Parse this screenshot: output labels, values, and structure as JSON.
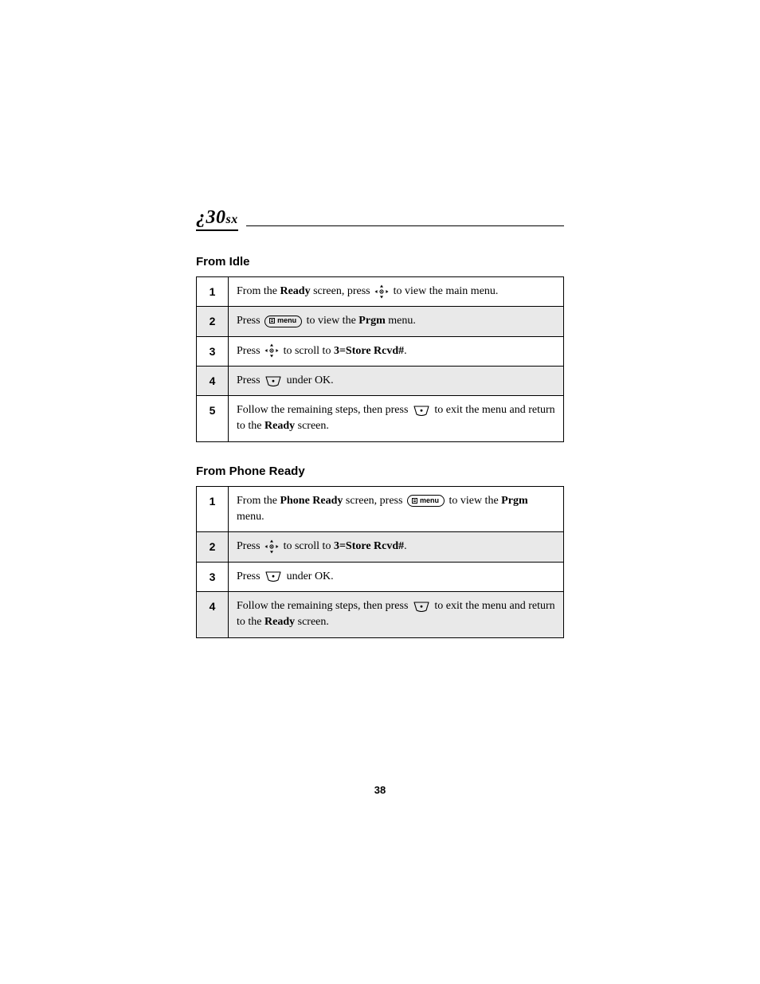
{
  "model_html": "<span>¿30</span><span class=\"sx\">sx</span>",
  "page_number": "38",
  "sectionA": {
    "title": "From Idle",
    "rows": [
      {
        "num": "1",
        "html": "From the <span class=\"bold-inline\">Ready</span> screen, press {{scroll}} to view the main menu."
      },
      {
        "num": "2",
        "html": "Press {{menu}} to view the <span class=\"bold-inline\">Prgm</span> menu."
      },
      {
        "num": "3",
        "html": "Press {{scroll}} to scroll to <span class=\"bold-inline\">3=Store Rcvd#</span>."
      },
      {
        "num": "4",
        "html": "Press {{ok}} under OK."
      },
      {
        "num": "5",
        "html": "Follow the remaining steps, then press {{ok}} to exit the menu and return to the <span class=\"bold-inline\">Ready</span> screen."
      }
    ]
  },
  "sectionB": {
    "title": "From Phone Ready",
    "rows": [
      {
        "num": "1",
        "html": "From the <span class=\"bold-inline\">Phone Ready</span> screen, press {{menu}} to view the <span class=\"bold-inline\">Prgm</span> menu."
      },
      {
        "num": "2",
        "html": "Press {{scroll}} to scroll to <span class=\"bold-inline\">3=Store Rcvd#</span>."
      },
      {
        "num": "3",
        "html": "Press {{ok}} under OK."
      },
      {
        "num": "4",
        "html": "Follow the remaining steps, then press {{ok}} to exit the menu and return to the <span class=\"bold-inline\">Ready</span> screen."
      }
    ]
  },
  "icons": {
    "menu_label": "menu"
  }
}
